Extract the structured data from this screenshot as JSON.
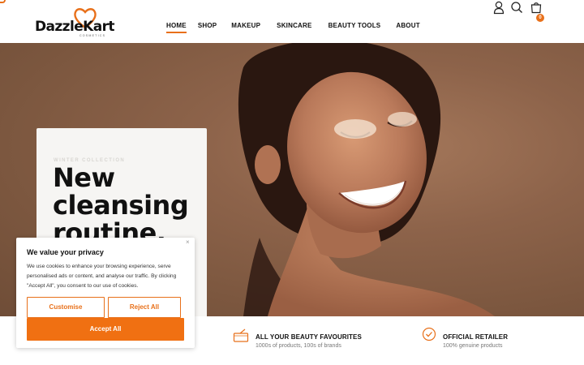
{
  "brand": {
    "name": "DazzleKart",
    "tagline": "COSMETICS",
    "accent_color": "#e8701a"
  },
  "nav": {
    "items": [
      {
        "label": "HOME",
        "active": true
      },
      {
        "label": "SHOP",
        "active": false
      },
      {
        "label": "MAKEUP",
        "active": false
      },
      {
        "label": "SKINCARE",
        "active": false
      },
      {
        "label": "BEAUTY TOOLS",
        "active": false
      },
      {
        "label": "ABOUT",
        "active": false
      }
    ]
  },
  "header_icons": {
    "account": "user-icon",
    "search": "search-icon",
    "cart": "shopping-bag-icon",
    "cart_count": "0"
  },
  "hero": {
    "eyebrow": "WINTER COLLECTION",
    "title_lines": [
      "New",
      "cleansing",
      "routine."
    ]
  },
  "features": [
    {
      "icon": "cosmetics-box-icon",
      "title": "ALL YOUR BEAUTY FAVOURITES",
      "subtitle": "1000s of products, 100s of brands"
    },
    {
      "icon": "verified-badge-icon",
      "title": "OFFICIAL RETAILER",
      "subtitle": "100% genuine products"
    }
  ],
  "cookie_banner": {
    "close": "×",
    "title": "We value your privacy",
    "text": "We use cookies to enhance your browsing experience, serve personalised ads or content, and analyse our traffic. By clicking \"Accept All\", you consent to our use of cookies.",
    "customise_label": "Customise",
    "reject_label": "Reject All",
    "accept_label": "Accept All"
  }
}
